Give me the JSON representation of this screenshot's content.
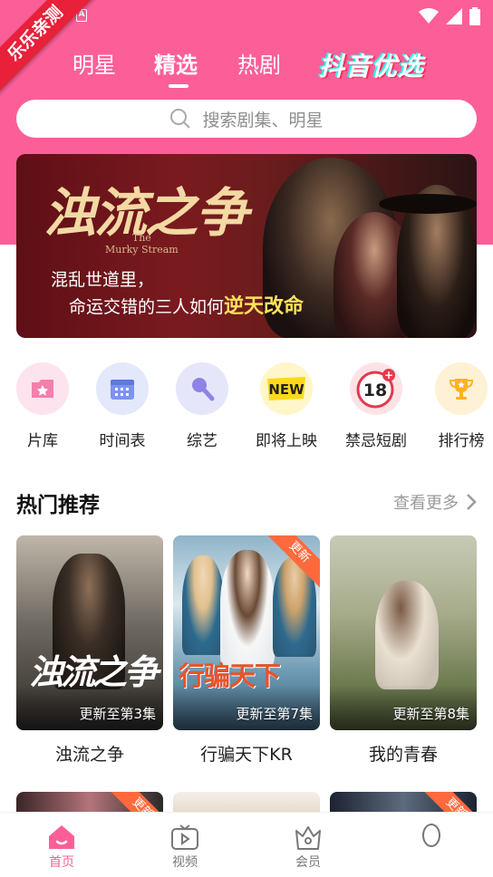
{
  "status": {
    "watermark": "乐乐亲测"
  },
  "top_tabs": [
    {
      "label": "明星"
    },
    {
      "label": "精选"
    },
    {
      "label": "热剧"
    },
    {
      "label": "抖音优选"
    }
  ],
  "search": {
    "placeholder": "搜索剧集、明星"
  },
  "banner": {
    "title": "浊流之争",
    "subtitle_en_1": "The",
    "subtitle_en_2": "Murky Stream",
    "tagline_1": "混乱世道里，",
    "tagline_2_prefix": "命运交错的三人如何",
    "tagline_2_highlight": "逆天改命"
  },
  "categories": [
    {
      "label": "片库",
      "icon": "film-library-icon"
    },
    {
      "label": "时间表",
      "icon": "calendar-icon"
    },
    {
      "label": "综艺",
      "icon": "microphone-icon"
    },
    {
      "label": "即将上映",
      "icon": "new-badge-icon"
    },
    {
      "label": "禁忌短剧",
      "icon": "18-plus-icon"
    },
    {
      "label": "排行榜",
      "icon": "trophy-icon"
    }
  ],
  "hot": {
    "title": "热门推荐",
    "see_more": "查看更多",
    "items": [
      {
        "title": "浊流之争",
        "episode": "更新至第3集",
        "poster_text": "浊流之争",
        "badge": ""
      },
      {
        "title": "行骗天下KR",
        "episode": "更新至第7集",
        "poster_text": "行骗天下",
        "badge": "更新"
      },
      {
        "title": "我的青春",
        "episode": "更新至第8集",
        "poster_text": "",
        "badge": ""
      }
    ],
    "row2_badges": [
      "更新",
      "",
      "更新"
    ]
  },
  "bottom_nav": [
    {
      "label": "首页",
      "icon": "home-icon"
    },
    {
      "label": "视频",
      "icon": "tv-icon"
    },
    {
      "label": "会员",
      "icon": "crown-icon"
    },
    {
      "label": "",
      "icon": "profile-icon"
    }
  ],
  "colors": {
    "brand": "#fc5f97",
    "badge": "#ff6a3d",
    "ribbon": "#e8203a"
  }
}
